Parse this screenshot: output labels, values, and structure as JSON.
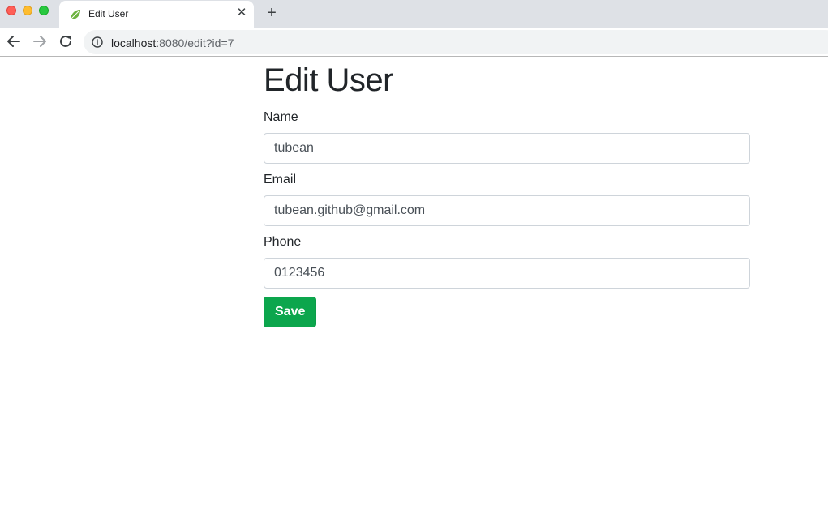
{
  "browser": {
    "tab": {
      "title": "Edit User",
      "favicon": "spring-leaf-icon",
      "close_glyph": "✕"
    },
    "new_tab_glyph": "+",
    "nav": {
      "back": "back-arrow-icon",
      "forward": "forward-arrow-icon",
      "reload": "reload-icon"
    },
    "address": {
      "host": "localhost",
      "rest": ":8080/edit?id=7",
      "info_icon": "info-icon"
    }
  },
  "page": {
    "title": "Edit User",
    "fields": {
      "name": {
        "label": "Name",
        "value": "tubean"
      },
      "email": {
        "label": "Email",
        "value": "tubean.github@gmail.com"
      },
      "phone": {
        "label": "Phone",
        "value": "0123456"
      }
    },
    "save_label": "Save"
  },
  "colors": {
    "save_button": "#0ca64d",
    "tabbar": "#dee1e6",
    "omnibox": "#f1f3f4"
  }
}
